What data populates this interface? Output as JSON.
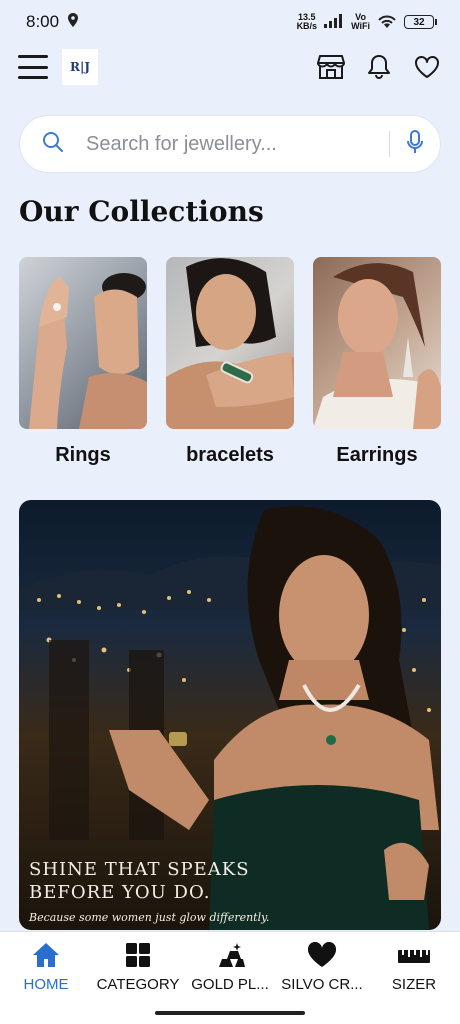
{
  "status_bar": {
    "time": "8:00",
    "net_speed_value": "13.5",
    "net_speed_unit": "KB/s",
    "network_label_top": "Vo",
    "network_label_bottom": "WiFi",
    "battery": "32"
  },
  "header": {
    "logo_text": "R|J"
  },
  "search": {
    "placeholder": "Search for jewellery..."
  },
  "collections": {
    "title": "Our Collections",
    "items": [
      {
        "label": "Rings"
      },
      {
        "label": "bracelets"
      },
      {
        "label": "Earrings"
      }
    ]
  },
  "banner": {
    "headline_line1": "SHINE THAT SPEAKS",
    "headline_line2": "BEFORE YOU DO.",
    "subtext": "Because some women just glow differently."
  },
  "bottom_nav": {
    "items": [
      {
        "label": "HOME",
        "icon": "home-icon"
      },
      {
        "label": "CATEGORY",
        "icon": "grid-icon"
      },
      {
        "label": "GOLD PL...",
        "icon": "gold-bars-icon"
      },
      {
        "label": "SILVO CR...",
        "icon": "heart-icon"
      },
      {
        "label": "SIZER",
        "icon": "ruler-icon"
      }
    ],
    "active": "HOME"
  },
  "colors": {
    "background": "#eaf0fb",
    "accent": "#2a6fcf",
    "banner_dark": "#0c1a2c"
  }
}
